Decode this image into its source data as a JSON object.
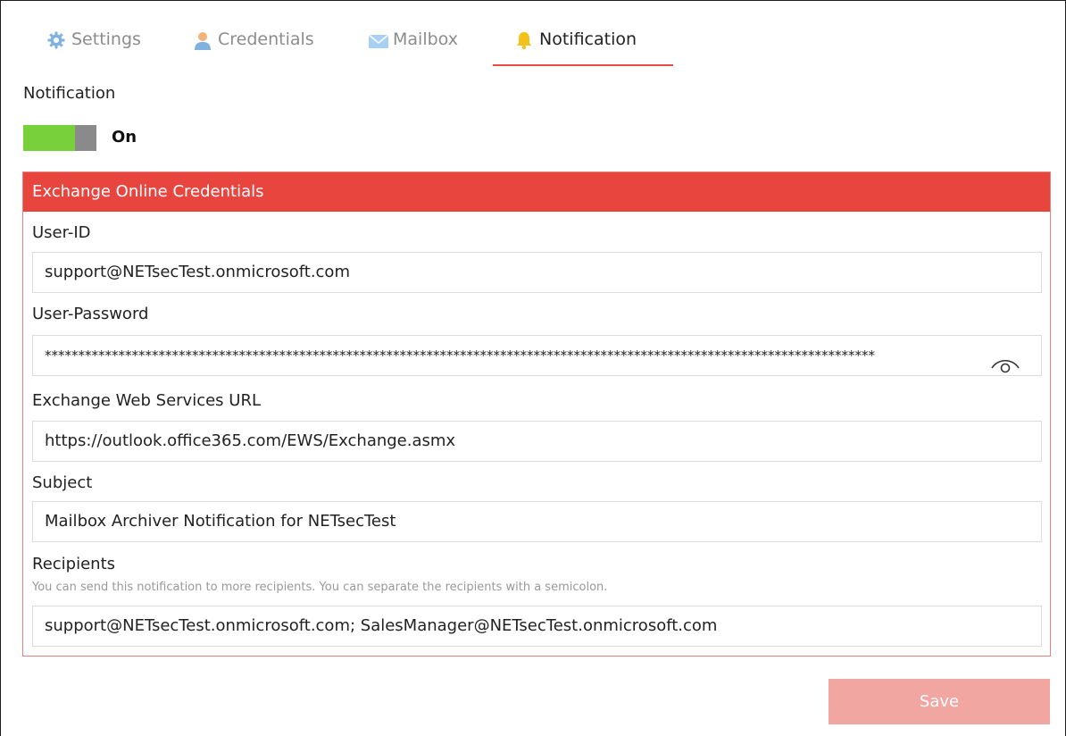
{
  "tabs": [
    {
      "label": "Settings",
      "icon": "gear-icon",
      "active": false
    },
    {
      "label": "Credentials",
      "icon": "user-icon",
      "active": false
    },
    {
      "label": "Mailbox",
      "icon": "envelope-icon",
      "active": false
    },
    {
      "label": "Notification",
      "icon": "bell-icon",
      "active": true
    }
  ],
  "notification": {
    "heading": "Notification",
    "toggle_state": "On",
    "enabled": true
  },
  "panel": {
    "title": "Exchange Online Credentials",
    "user_id_label": "User-ID",
    "user_id_value": "support@NETsecTest.onmicrosoft.com",
    "password_label": "User-Password",
    "password_value": "****************************************************************************************************************************",
    "ews_label": "Exchange Web Services URL",
    "ews_value": "https://outlook.office365.com/EWS/Exchange.asmx",
    "subject_label": "Subject",
    "subject_value": "Mailbox Archiver Notification for NETsecTest",
    "recipients_label": "Recipients",
    "recipients_hint": "You can send this notification to more recipients. You can separate the recipients with a semicolon.",
    "recipients_value": "support@NETsecTest.onmicrosoft.com; SalesManager@NETsecTest.onmicrosoft.com"
  },
  "actions": {
    "save_label": "Save"
  },
  "colors": {
    "accent": "#e8453f",
    "toggle_on": "#78d13a",
    "save_disabled": "#f2a6a2"
  }
}
